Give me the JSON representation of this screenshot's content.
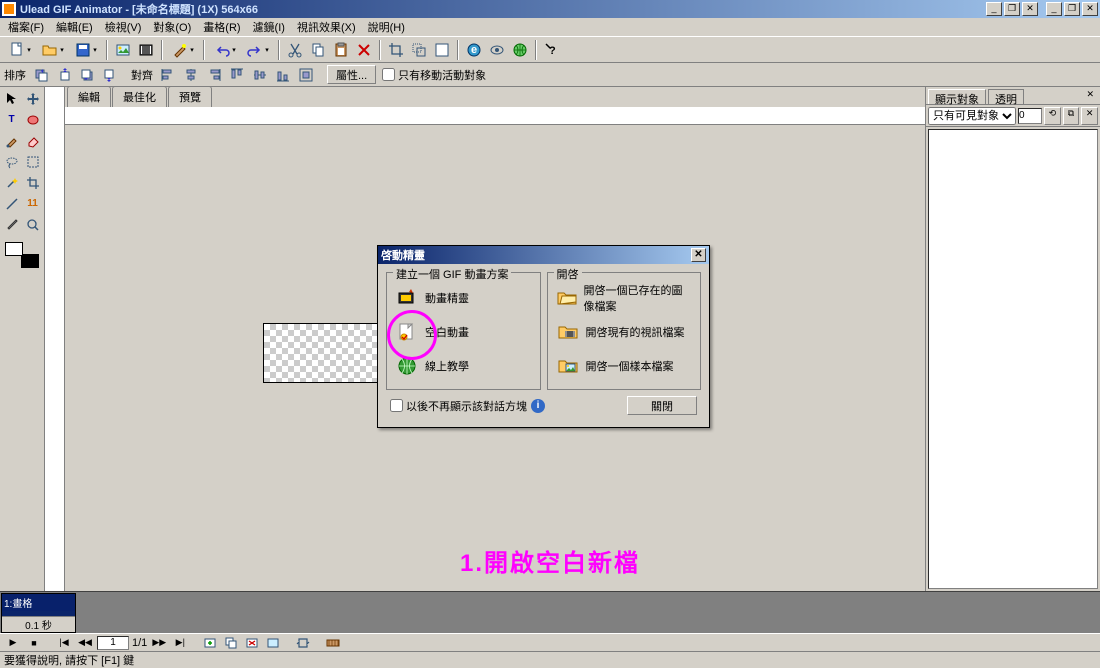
{
  "title": "Ulead GIF Animator - [未命名標題] (1X) 564x66",
  "menus": [
    "檔案(F)",
    "編輯(E)",
    "檢視(V)",
    "對象(O)",
    "畫格(R)",
    "濾鏡(I)",
    "視訊效果(X)",
    "說明(H)"
  ],
  "toolbar2": {
    "l1": "排序",
    "l2": "對齊",
    "prop": "屬性...",
    "cb": "只有移動活動對象"
  },
  "tabs": [
    "編輯",
    "最佳化",
    "預覽"
  ],
  "rpanel": {
    "t1": "顯示對象",
    "t2": "透明",
    "sel": "只有可見對象"
  },
  "frame": {
    "num": "1:畫格",
    "time": "0.1 秒"
  },
  "play": {
    "cur": "1",
    "total": "1/1"
  },
  "status": "要獲得說明, 請按下 [F1] 鍵",
  "dlg": {
    "title": "啓動精靈",
    "g1": "建立一個 GIF 動畫方案",
    "g2": "開啓",
    "o1": "動畫精靈",
    "o2": "空白動畫",
    "o3": "線上教學",
    "r1": "開啓一個已存在的圖像檔案",
    "r2": "開啓現有的視訊檔案",
    "r3": "開啓一個樣本檔案",
    "cb": "以後不再顯示該對話方塊",
    "close": "關閉"
  },
  "anno": "1.開啟空白新檔"
}
